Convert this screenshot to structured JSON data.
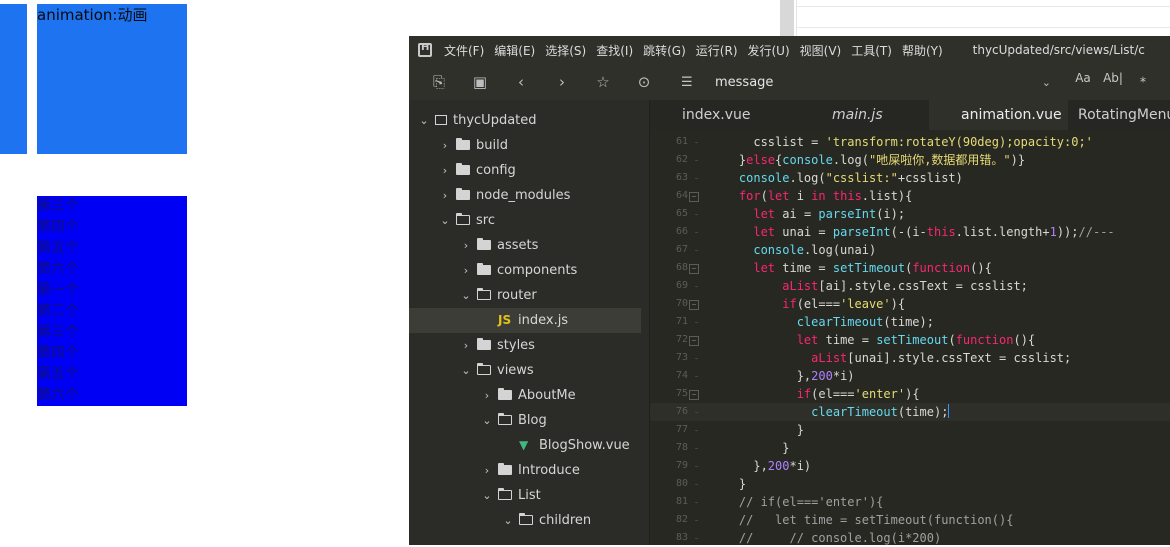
{
  "page": {
    "anim_label": "animation:动画",
    "list_items": [
      "第三个",
      "第四个",
      "第五个",
      "第六个",
      "第一个",
      "第二个",
      "第三个",
      "第四个",
      "第五个",
      "第六个"
    ]
  },
  "ide": {
    "menu": [
      "文件(F)",
      "编辑(E)",
      "选择(S)",
      "查找(I)",
      "跳转(G)",
      "运行(R)",
      "发行(U)",
      "视图(V)",
      "工具(T)",
      "帮助(Y)"
    ],
    "path_title": "thycUpdated/src/views/List/c",
    "search_value": "message",
    "tools_right": [
      "Aa",
      "Ab|",
      "⁎"
    ],
    "tabs": [
      "index.vue",
      "main.js",
      "animation.vue",
      "RotatingMenu."
    ],
    "active_tab": "animation.vue",
    "tree": [
      {
        "label": "thycUpdated",
        "depth": 0,
        "kind": "project",
        "expanded": true
      },
      {
        "label": "build",
        "depth": 1,
        "kind": "folder",
        "expanded": false
      },
      {
        "label": "config",
        "depth": 1,
        "kind": "folder",
        "expanded": false
      },
      {
        "label": "node_modules",
        "depth": 1,
        "kind": "folder",
        "expanded": false
      },
      {
        "label": "src",
        "depth": 1,
        "kind": "folder",
        "expanded": true
      },
      {
        "label": "assets",
        "depth": 2,
        "kind": "folder",
        "expanded": false
      },
      {
        "label": "components",
        "depth": 2,
        "kind": "folder",
        "expanded": false
      },
      {
        "label": "router",
        "depth": 2,
        "kind": "folder",
        "expanded": true
      },
      {
        "label": "index.js",
        "depth": 3,
        "kind": "js",
        "selected": true
      },
      {
        "label": "styles",
        "depth": 2,
        "kind": "folder",
        "expanded": false
      },
      {
        "label": "views",
        "depth": 2,
        "kind": "folder",
        "expanded": true
      },
      {
        "label": "AboutMe",
        "depth": 3,
        "kind": "folder",
        "expanded": false
      },
      {
        "label": "Blog",
        "depth": 3,
        "kind": "folder",
        "expanded": true
      },
      {
        "label": "BlogShow.vue",
        "depth": 4,
        "kind": "vue"
      },
      {
        "label": "Introduce",
        "depth": 3,
        "kind": "folder",
        "expanded": false
      },
      {
        "label": "List",
        "depth": 3,
        "kind": "folder",
        "expanded": true
      },
      {
        "label": "children",
        "depth": 4,
        "kind": "folder",
        "expanded": true
      }
    ],
    "code": [
      {
        "n": "61",
        "html": "      csslist = <span class='s'>'transform:rotateY(90deg);opacity:0;'</span>"
      },
      {
        "n": "62",
        "html": "    }<span class='k'>else</span>{<span class='f'>console</span>.log(<span class='s'>\"吔屎啦你,数据都用错。\"</span>)}"
      },
      {
        "n": "63",
        "html": "    <span class='f'>console</span>.log(<span class='s'>\"csslist:\"</span>+csslist)"
      },
      {
        "n": "64",
        "fold": true,
        "html": "    <span class='k'>for</span>(<span class='k'>let</span> i <span class='k'>in</span> <span class='k'>this</span>.list){"
      },
      {
        "n": "65",
        "html": "      <span class='k'>let</span> ai = <span class='f'>parseInt</span>(i);"
      },
      {
        "n": "66",
        "html": "      <span class='k'>let</span> unai = <span class='f'>parseInt</span>(-(i-<span class='k'>this</span>.list.length+<span class='n'>1</span>));<span class='c'>//---</span>"
      },
      {
        "n": "67",
        "html": "      <span class='f'>console</span>.log(unai)"
      },
      {
        "n": "68",
        "fold": true,
        "html": "      <span class='k'>let</span> time = <span class='f'>setTimeout</span>(<span class='k'>function</span>(){"
      },
      {
        "n": "69",
        "html": "          <span class='k'>aList</span>[ai].style.cssText = csslist;"
      },
      {
        "n": "70",
        "fold": true,
        "html": "          <span class='k'>if</span>(el===<span class='s'>'leave'</span>){"
      },
      {
        "n": "71",
        "html": "            <span class='f'>clearTimeout</span>(time);"
      },
      {
        "n": "72",
        "fold": true,
        "html": "            <span class='k'>let</span> time = <span class='f'>setTimeout</span>(<span class='k'>function</span>(){"
      },
      {
        "n": "73",
        "html": "              <span class='k'>aList</span>[unai].style.cssText = csslist;"
      },
      {
        "n": "74",
        "html": "            },<span class='n'>200</span>*i)"
      },
      {
        "n": "75",
        "fold": true,
        "html": "            <span class='k'>if</span>(el===<span class='s'>'enter'</span>){"
      },
      {
        "n": "76",
        "cur": true,
        "html": "              <span class='f'>clearTimeout</span>(time);<span class='caret'></span>"
      },
      {
        "n": "77",
        "html": "            }"
      },
      {
        "n": "78",
        "html": "          }"
      },
      {
        "n": "79",
        "html": "      },<span class='n'>200</span>*i)"
      },
      {
        "n": "80",
        "html": "    }"
      },
      {
        "n": "81",
        "html": "    <span class='c'>// if(el==='enter'){</span>"
      },
      {
        "n": "82",
        "html": "    <span class='c'>//   let time = setTimeout(function(){</span>"
      },
      {
        "n": "83",
        "html": "    <span class='c'>//     // console.log(i*200)</span>"
      }
    ]
  }
}
